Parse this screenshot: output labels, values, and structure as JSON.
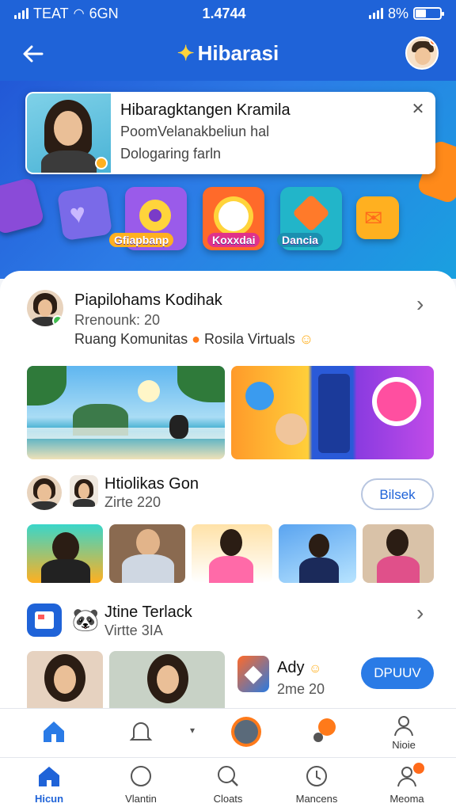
{
  "status_bar": {
    "carrier": "TEAT",
    "network": "6GN",
    "time": "1.4744",
    "battery": "8%"
  },
  "header": {
    "title": "Hibarasi"
  },
  "banner": {
    "notification": {
      "title": "Hibaragktangen Kramila",
      "line1": "PoomVelanakbeliun hal",
      "line2": "Dologaring farln"
    },
    "tiles": [
      {
        "label": "Gfiapbanp",
        "color": "#7a4be0"
      },
      {
        "label": "Koxxdai",
        "color": "#ff6a2a"
      },
      {
        "label": "Dancia",
        "color": "#22b5c9"
      }
    ]
  },
  "posts": [
    {
      "title": "Piapilohams Kodihak",
      "subtitle": "Rrenounk: 20",
      "caption": "Ruang Komunitas",
      "caption2": "Rosila Virtuals"
    },
    {
      "title": "Htiolikas Gon",
      "subtitle": "Zirte 220",
      "button": "Bilsek"
    },
    {
      "title": "Jtine Terlack",
      "subtitle": "Virtte 3IA"
    },
    {
      "title": "Ady",
      "subtitle": "2me 20",
      "button": "DPUUV"
    }
  ],
  "nav_upper": [
    {
      "icon": "home-icon",
      "label": ""
    },
    {
      "icon": "bell-icon",
      "label": ""
    },
    {
      "icon": "compass-icon",
      "label": ""
    },
    {
      "icon": "sparkle-icon",
      "label": ""
    },
    {
      "icon": "person-icon",
      "label": "Nioie"
    }
  ],
  "nav_lower": [
    {
      "icon": "home-icon",
      "label": "Hicun",
      "active": true
    },
    {
      "icon": "circle-icon",
      "label": "Vlantin"
    },
    {
      "icon": "search-icon",
      "label": "Cloats"
    },
    {
      "icon": "clock-icon",
      "label": "Mancens"
    },
    {
      "icon": "profile-icon",
      "label": "Meoma"
    }
  ],
  "colors": {
    "primary": "#1f63d8",
    "accent": "#ff6a1a",
    "highlight": "#ffd43b"
  }
}
